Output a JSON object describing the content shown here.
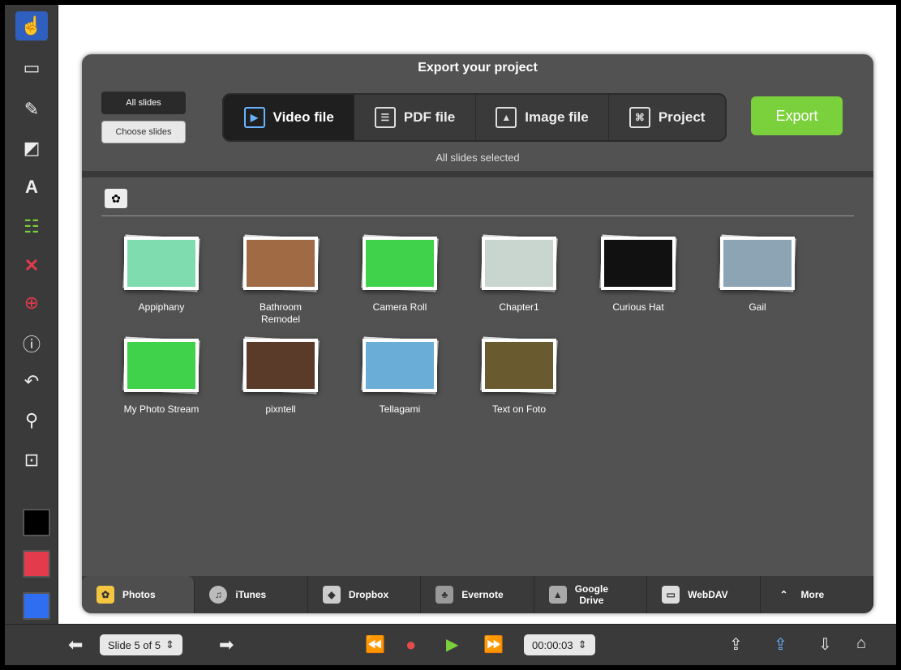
{
  "panel": {
    "title": "Export your project",
    "all_slides": "All slides",
    "choose_slides": "Choose slides",
    "formats": [
      {
        "label": "Video file",
        "icon": "video-file-icon",
        "active": true
      },
      {
        "label": "PDF file",
        "icon": "pdf-file-icon"
      },
      {
        "label": "Image file",
        "icon": "image-file-icon"
      },
      {
        "label": "Project",
        "icon": "project-icon"
      }
    ],
    "export_label": "Export",
    "status": "All slides selected",
    "accent": "#7bd13b"
  },
  "albums": [
    {
      "name": "Appiphany",
      "color": "#7fdcae"
    },
    {
      "name": "Bathroom\nRemodel",
      "color": "#a06a45"
    },
    {
      "name": "Camera Roll",
      "color": "#3fd24a"
    },
    {
      "name": "Chapter1",
      "color": "#c9d6cf"
    },
    {
      "name": "Curious Hat",
      "color": "#111111"
    },
    {
      "name": "Gail",
      "color": "#8da4b4"
    },
    {
      "name": "My Photo Stream",
      "color": "#3fd24a"
    },
    {
      "name": "pixntell",
      "color": "#5a3a28"
    },
    {
      "name": "Tellagami",
      "color": "#6aaed8"
    },
    {
      "name": "Text on Foto",
      "color": "#6a5a30"
    }
  ],
  "sources": [
    {
      "label": "Photos",
      "icon": "photos-icon",
      "active": true
    },
    {
      "label": "iTunes",
      "icon": "itunes-icon"
    },
    {
      "label": "Dropbox",
      "icon": "dropbox-icon"
    },
    {
      "label": "Evernote",
      "icon": "evernote-icon"
    },
    {
      "label": "Google\nDrive",
      "icon": "google-drive-icon"
    },
    {
      "label": "WebDAV",
      "icon": "webdav-icon"
    },
    {
      "label": "More",
      "icon": "chevron-up-icon"
    }
  ],
  "bottom": {
    "slide_indicator": "Slide 5 of 5",
    "time": "00:00:03"
  },
  "swatches": [
    "#000000",
    "#e33b4b",
    "#2f6ef0"
  ]
}
